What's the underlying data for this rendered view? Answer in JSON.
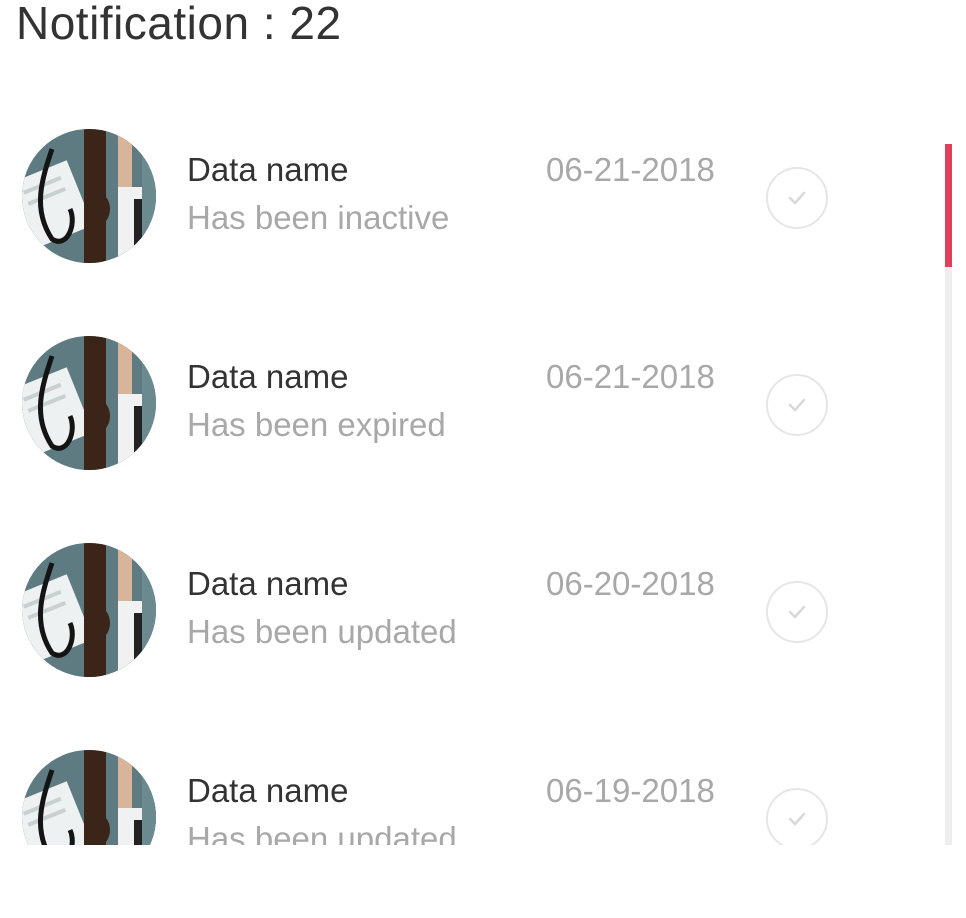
{
  "header": {
    "title": "Notification : 22"
  },
  "colors": {
    "accent": "#e0405a",
    "title_text": "#333333",
    "muted_text": "#a8a8a8",
    "check_outline": "#e6e6e6"
  },
  "notifications": [
    {
      "title": "Data name",
      "subtitle": "Has been inactive",
      "date": "06-21-2018",
      "icon": "check-circle-icon"
    },
    {
      "title": "Data name",
      "subtitle": "Has been expired",
      "date": "06-21-2018",
      "icon": "check-circle-icon"
    },
    {
      "title": "Data name",
      "subtitle": "Has been updated",
      "date": "06-20-2018",
      "icon": "check-circle-icon"
    },
    {
      "title": "Data name",
      "subtitle": "Has been updated",
      "date": "06-19-2018",
      "icon": "check-circle-icon"
    }
  ],
  "scrollbar": {
    "position_fraction": 0.0
  }
}
